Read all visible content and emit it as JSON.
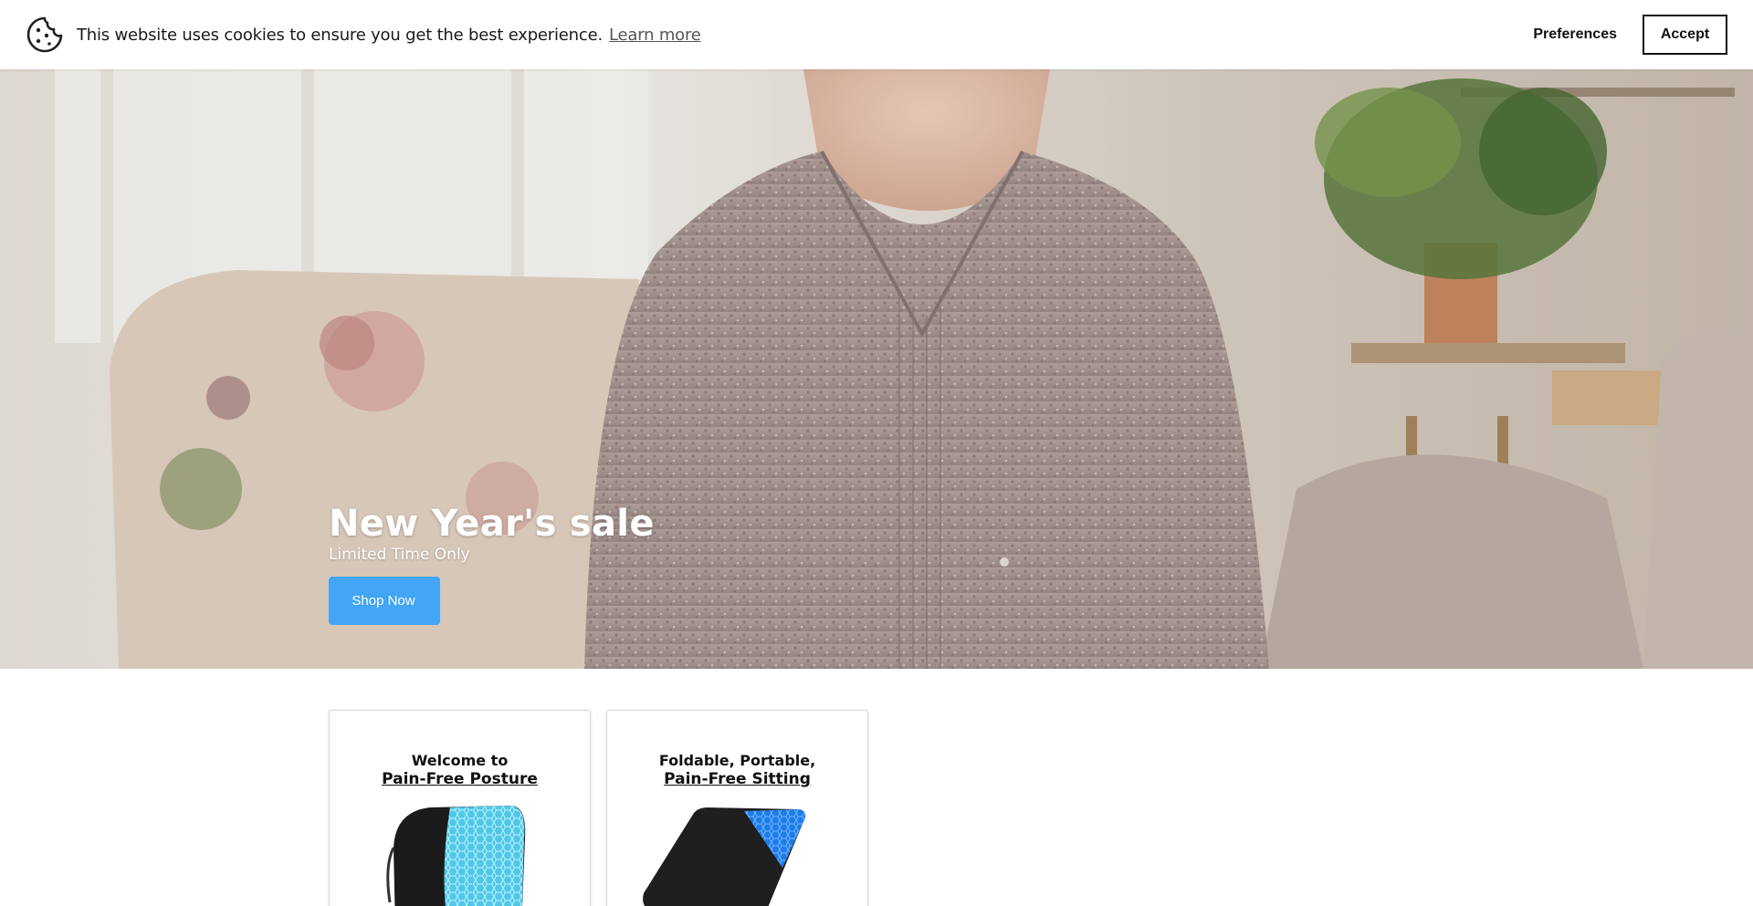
{
  "cookie_bar": {
    "message": "This website uses cookies to ensure you get the best experience.",
    "learn_more": "Learn more",
    "preferences": "Preferences",
    "accept": "Accept",
    "icon": "cookie-icon"
  },
  "hero": {
    "title": "New Year's sale",
    "subtitle": "Limited Time Only",
    "cta_label": "Shop Now",
    "cta_icon": "",
    "cta_color": "#42a5f5"
  },
  "cards": [
    {
      "line1": "Welcome to",
      "link": "Pain-Free Posture",
      "image": "lumbar-support-cushion"
    },
    {
      "line1": "Foldable, Portable,",
      "link": "Pain-Free Sitting",
      "image": "foldable-seat-cushion"
    }
  ]
}
